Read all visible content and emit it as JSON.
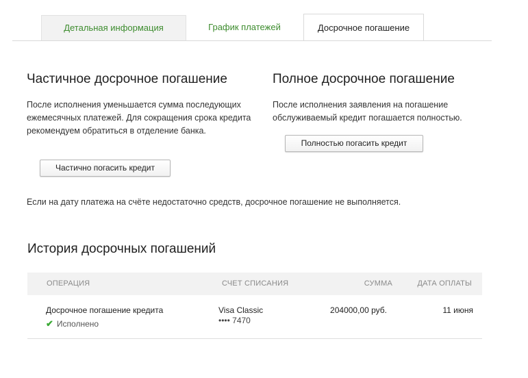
{
  "tabs": [
    {
      "label": "Детальная информация"
    },
    {
      "label": "График платежей"
    },
    {
      "label": "Досрочное погашение"
    }
  ],
  "partial": {
    "title": "Частичное досрочное погашение",
    "text": "После исполнения уменьшается сумма последующих ежемесячных платежей. Для сокращения срока кредита рекомендуем обратиться в отделение банка.",
    "button": "Частично погасить кредит"
  },
  "full": {
    "title": "Полное досрочное погашение",
    "text": "После исполнения заявления на погашение обслуживаемый кредит погашается полностью.",
    "button": "Полностью погасить кредит"
  },
  "note": "Если на дату платежа на счёте недостаточно средств, досрочное погашение не выполняется.",
  "history": {
    "title": "История досрочных погашений",
    "columns": {
      "operation": "Операция",
      "account": "Счет списания",
      "amount": "Сумма",
      "date": "Дата оплаты"
    },
    "rows": [
      {
        "operation": "Досрочное погашение кредита",
        "status": "Исполнено",
        "status_icon": "check-icon",
        "account": "Visa Classic",
        "account_mask": "•••• 7470",
        "amount": "204000,00 руб.",
        "date": "11 июня"
      }
    ]
  },
  "colors": {
    "accent": "#3d8c2e",
    "check": "#3aa935"
  }
}
